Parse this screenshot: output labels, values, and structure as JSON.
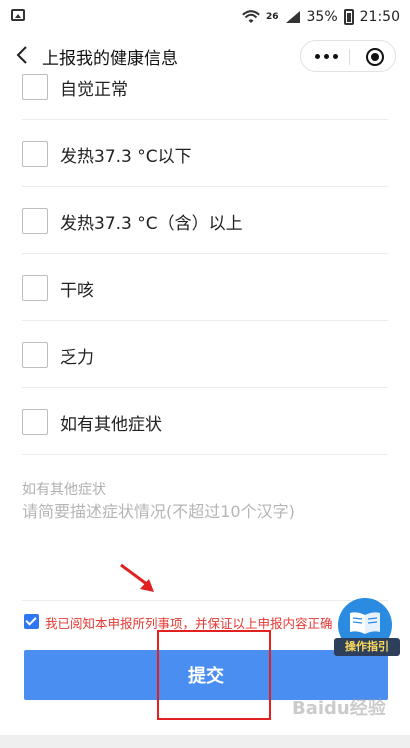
{
  "status_bar": {
    "network": "26",
    "battery": "35%",
    "time": "21:50"
  },
  "nav": {
    "title": "上报我的健康信息"
  },
  "options": [
    {
      "label": "自觉正常"
    },
    {
      "label": "发热37.3 °C以下"
    },
    {
      "label": "发热37.3 °C（含）以上"
    },
    {
      "label": "干咳"
    },
    {
      "label": "乏力"
    },
    {
      "label": "如有其他症状"
    }
  ],
  "other_symptoms": {
    "label": "如有其他症状",
    "placeholder": "请简要描述症状情况(不超过10个汉字)"
  },
  "agreement": {
    "checked": true,
    "text": "我已阅知本申报所列事项，并保证以上申报内容正确"
  },
  "submit": {
    "label": "提交"
  },
  "guide": {
    "label": "操作指引"
  },
  "watermark": "Baidu经验",
  "colors": {
    "primary_button": "#4a8ef2",
    "agreement_text": "#e53935",
    "checkbox_checked": "#2f76f5",
    "annotation": "#e32020"
  }
}
